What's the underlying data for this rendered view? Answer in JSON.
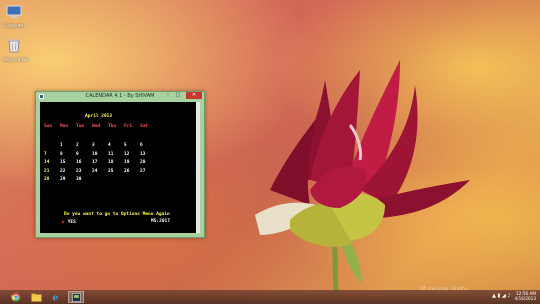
{
  "desktop": {
    "icons": [
      {
        "label": "Computer"
      },
      {
        "label": "Recycle Bin"
      }
    ],
    "watermark": "Ranjan Arts"
  },
  "window": {
    "title": "CALENDAR 4.1 - By SHIVAM",
    "buttons": {
      "minimize": "–",
      "maximize": "□",
      "close": "✕"
    }
  },
  "calendar": {
    "month_label": "April 2013",
    "day_headers": [
      "Sun",
      "Mon",
      "Tue",
      "Wed",
      "Thu",
      "Fri",
      "Sat"
    ],
    "weeks": [
      [
        "",
        "1",
        "2",
        "3",
        "4",
        "5",
        "6"
      ],
      [
        "7",
        "8",
        "9",
        "10",
        "11",
        "12",
        "13"
      ],
      [
        "14",
        "15",
        "16",
        "17",
        "18",
        "19",
        "20"
      ],
      [
        "21",
        "22",
        "23",
        "24",
        "25",
        "26",
        "27"
      ],
      [
        "28",
        "29",
        "30",
        "",
        "",
        "",
        ""
      ]
    ],
    "prompt": "Do you want to go to Options Menu Again",
    "yes_label": "YES",
    "ms_label": "MS:2017"
  },
  "taskbar": {
    "apps": [
      {
        "name": "chrome-icon"
      },
      {
        "name": "file-explorer-icon"
      },
      {
        "name": "internet-explorer-icon"
      },
      {
        "name": "calendar-app-icon"
      }
    ],
    "clock": {
      "time": "12:56 AM",
      "date": "4/16/2013"
    }
  },
  "colors": {
    "console_bg": "#000000",
    "month_label": "#ffff55",
    "day_headers": "#ff5555",
    "window_frame": "#a8d1a0",
    "close_button": "#c7372f"
  }
}
